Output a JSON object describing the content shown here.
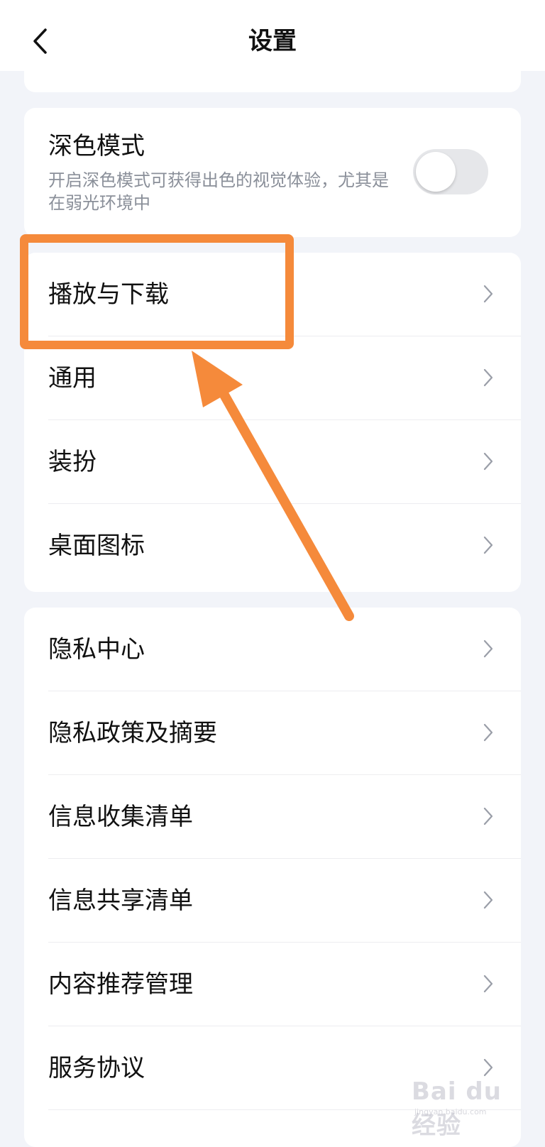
{
  "header": {
    "title": "设置",
    "back_icon": "chevron-left-icon"
  },
  "dark_mode": {
    "title": "深色模式",
    "description": "开启深色模式可获得出色的视觉体验，尤其是在弱光环境中",
    "enabled": false
  },
  "group1": {
    "items": [
      {
        "label": "播放与下载"
      },
      {
        "label": "通用"
      },
      {
        "label": "装扮"
      },
      {
        "label": "桌面图标"
      }
    ]
  },
  "group2": {
    "items": [
      {
        "label": "隐私中心"
      },
      {
        "label": "隐私政策及摘要"
      },
      {
        "label": "信息收集清单"
      },
      {
        "label": "信息共享清单"
      },
      {
        "label": "内容推荐管理"
      },
      {
        "label": "服务协议"
      }
    ]
  },
  "annotation": {
    "color": "#f58a3b"
  },
  "watermark": {
    "text": "Bai du 经验",
    "sub": "jingyan.baidu.com"
  }
}
